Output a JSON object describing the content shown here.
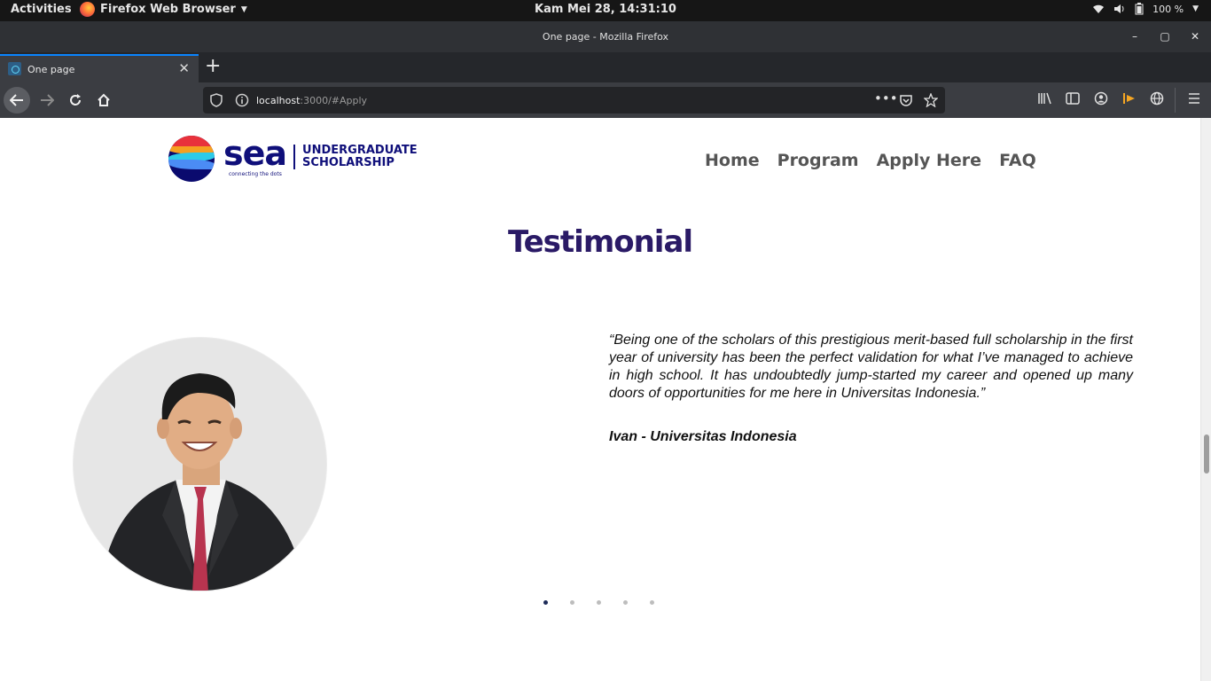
{
  "os_topbar": {
    "activities": "Activities",
    "app_name": "Firefox Web Browser",
    "clock": "Kam Mei 28, 14:31:10",
    "battery": "100 %"
  },
  "window": {
    "title": "One page - Mozilla Firefox"
  },
  "browser": {
    "tab_title": "One page",
    "url_host": "localhost",
    "url_rest": ":3000/#Apply"
  },
  "site": {
    "logo_word": "sea",
    "logo_tagline": "connecting the dots",
    "logo_sub_line1": "UNDERGRADUATE",
    "logo_sub_line2": "SCHOLARSHIP",
    "nav": [
      "Home",
      "Program",
      "Apply Here",
      "FAQ"
    ]
  },
  "testimonial": {
    "heading": "Testimonial",
    "quote": "“Being one of the scholars of this prestigious merit-based full scholarship in the first year of university has been the perfect validation for what I’ve managed to achieve in high school. It has undoubtedly jump-started my career and opened up many doors of opportunities for me here in Universitas Indonesia.”",
    "author": "Ivan - Universitas Indonesia",
    "slides_total": 5,
    "active_slide": 1
  },
  "colors": {
    "heading": "#2a1a66",
    "brand": "#0f0f7a",
    "dot_active": "#1d2b58",
    "dot_inactive": "#bdbdbd"
  }
}
